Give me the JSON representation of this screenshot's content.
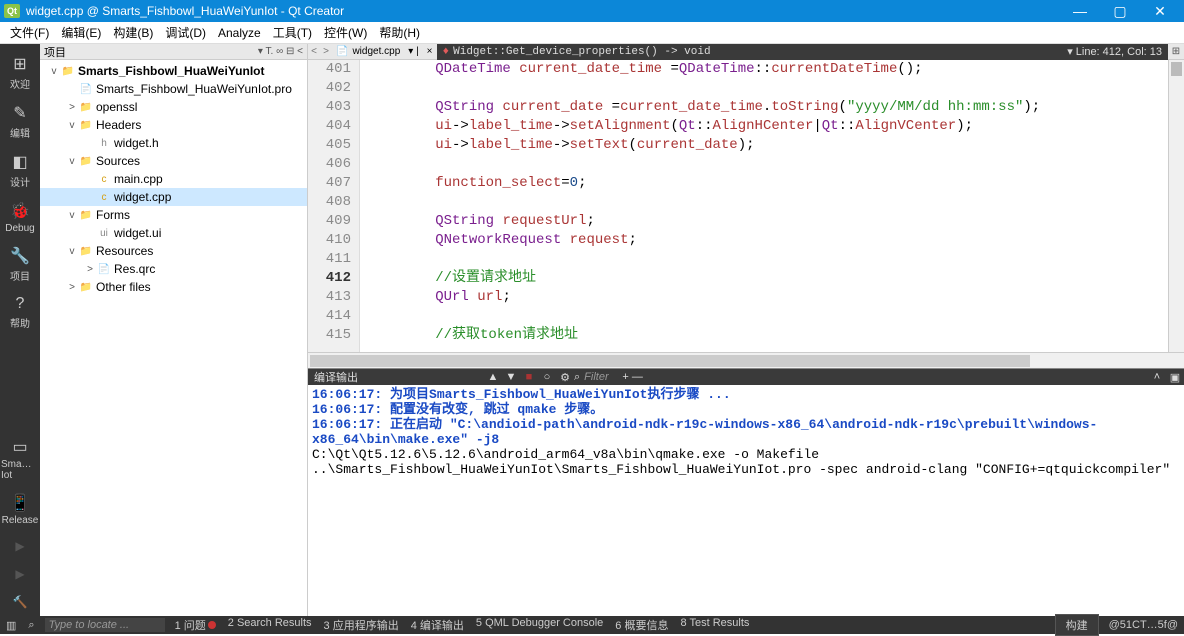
{
  "window": {
    "title": "widget.cpp @ Smarts_Fishbowl_HuaWeiYunIot - Qt Creator",
    "logo": "Qt"
  },
  "menu": [
    "文件(F)",
    "编辑(E)",
    "构建(B)",
    "调试(D)",
    "Analyze",
    "工具(T)",
    "控件(W)",
    "帮助(H)"
  ],
  "leftbar": {
    "items": [
      {
        "icon": "⊞",
        "label": "欢迎"
      },
      {
        "icon": "✎",
        "label": "编辑"
      },
      {
        "icon": "◧",
        "label": "设计"
      },
      {
        "icon": "🐞",
        "label": "Debug"
      },
      {
        "icon": "🔧",
        "label": "项目"
      },
      {
        "icon": "?",
        "label": "帮助"
      }
    ],
    "bottom": [
      {
        "icon": "▭",
        "label": "Sma…Iot"
      },
      {
        "icon": "📱",
        "label": "Release"
      }
    ]
  },
  "project_panel": {
    "title": "项目",
    "actions": "▾ T. ∞ ⊟ <"
  },
  "tree": [
    {
      "depth": 0,
      "exp": "v",
      "icon": "📁",
      "iconcls": "fold-g",
      "label": "Smarts_Fishbowl_HuaWeiYunIot",
      "bold": true
    },
    {
      "depth": 1,
      "exp": "",
      "icon": "📄",
      "iconcls": "file-q",
      "label": "Smarts_Fishbowl_HuaWeiYunIot.pro"
    },
    {
      "depth": 1,
      "exp": ">",
      "icon": "📁",
      "iconcls": "fold-b",
      "label": "openssl"
    },
    {
      "depth": 1,
      "exp": "v",
      "icon": "📁",
      "iconcls": "fold-g",
      "label": "Headers"
    },
    {
      "depth": 2,
      "exp": "",
      "icon": "h",
      "iconcls": "file-h",
      "label": "widget.h"
    },
    {
      "depth": 1,
      "exp": "v",
      "icon": "📁",
      "iconcls": "fold-g",
      "label": "Sources"
    },
    {
      "depth": 2,
      "exp": "",
      "icon": "c",
      "iconcls": "file-c",
      "label": "main.cpp"
    },
    {
      "depth": 2,
      "exp": "",
      "icon": "c",
      "iconcls": "file-c",
      "label": "widget.cpp",
      "sel": true
    },
    {
      "depth": 1,
      "exp": "v",
      "icon": "📁",
      "iconcls": "fold-g",
      "label": "Forms"
    },
    {
      "depth": 2,
      "exp": "",
      "icon": "ui",
      "iconcls": "file-u",
      "label": "widget.ui"
    },
    {
      "depth": 1,
      "exp": "v",
      "icon": "📁",
      "iconcls": "fold-g",
      "label": "Resources"
    },
    {
      "depth": 2,
      "exp": ">",
      "icon": "📄",
      "iconcls": "file-q",
      "label": "Res.qrc"
    },
    {
      "depth": 1,
      "exp": ">",
      "icon": "📁",
      "iconcls": "fold-b",
      "label": "Other files"
    }
  ],
  "editor": {
    "filename": "widget.cpp",
    "close": "×",
    "breadcrumb_icon": "♦",
    "breadcrumb": "Widget::Get_device_properties() -> void",
    "lineinfo": "▾ Line: 412, Col: 13",
    "nav_left": "<",
    "nav_right": ">",
    "filter_glyph": "⌕"
  },
  "code": {
    "start": 401,
    "active": 412,
    "lines": [
      {
        "n": 401,
        "html": "        <span class='typ'>QDateTime</span> <span class='id'>current_date_time</span> =<span class='typ'>QDateTime</span>::<span class='id'>currentDateTime</span>();"
      },
      {
        "n": 402,
        "html": ""
      },
      {
        "n": 403,
        "html": "        <span class='typ'>QString</span> <span class='id'>current_date</span> =<span class='id'>current_date_time</span>.<span class='id'>toString</span>(<span class='str'>\"yyyy/MM/dd hh:mm:ss\"</span>);"
      },
      {
        "n": 404,
        "html": "        <span class='id'>ui</span>-><span class='id'>label_time</span>-><span class='id'>setAlignment</span>(<span class='typ'>Qt</span>::<span class='id'>AlignHCenter</span>|<span class='typ'>Qt</span>::<span class='id'>AlignVCenter</span>);"
      },
      {
        "n": 405,
        "html": "        <span class='id'>ui</span>-><span class='id'>label_time</span>-><span class='id'>setText</span>(<span class='id'>current_date</span>);"
      },
      {
        "n": 406,
        "html": ""
      },
      {
        "n": 407,
        "html": "        <span class='id'>function_select</span>=<span class='num'>0</span>;"
      },
      {
        "n": 408,
        "html": ""
      },
      {
        "n": 409,
        "html": "        <span class='typ'>QString</span> <span class='id'>requestUrl</span>;"
      },
      {
        "n": 410,
        "html": "        <span class='typ'>QNetworkRequest</span> <span class='id'>request</span>;"
      },
      {
        "n": 411,
        "html": ""
      },
      {
        "n": 412,
        "html": "        <span class='cmt'>//设置请求地址</span>"
      },
      {
        "n": 413,
        "html": "        <span class='typ'>QUrl</span> <span class='id'>url</span>;"
      },
      {
        "n": 414,
        "html": ""
      },
      {
        "n": 415,
        "html": "        <span class='cmt'>//获取token请求地址</span>"
      }
    ]
  },
  "output": {
    "title": "编译输出",
    "filter_placeholder": "Filter",
    "plusminus": "+ —",
    "lines": [
      {
        "cls": "ob",
        "text": "16:06:17: 为项目Smarts_Fishbowl_HuaWeiYunIot执行步骤 ..."
      },
      {
        "cls": "ob",
        "text": "16:06:17: 配置没有改变, 跳过 qmake 步骤。"
      },
      {
        "cls": "ob",
        "text": "16:06:17: 正在启动 \"C:\\andioid-path\\android-ndk-r19c-windows-x86_64\\android-ndk-r19c\\prebuilt\\windows-x86_64\\bin\\make.exe\" -j8"
      },
      {
        "cls": "on",
        "text": ""
      },
      {
        "cls": "on",
        "text": "C:\\Qt\\Qt5.12.6\\5.12.6\\android_arm64_v8a\\bin\\qmake.exe -o Makefile ..\\Smarts_Fishbowl_HuaWeiYunIot\\Smarts_Fishbowl_HuaWeiYunIot.pro -spec android-clang \"CONFIG+=qtquickcompiler\""
      }
    ]
  },
  "statusbar": {
    "search_placeholder": "Type to locate ...",
    "build_label": "构建",
    "right": "@51CT…5f@"
  },
  "status_tabs": [
    "1 问题",
    "2 Search Results",
    "3 应用程序输出",
    "4 编译输出",
    "5 QML Debugger Console",
    "6 概要信息",
    "8 Test Results"
  ]
}
